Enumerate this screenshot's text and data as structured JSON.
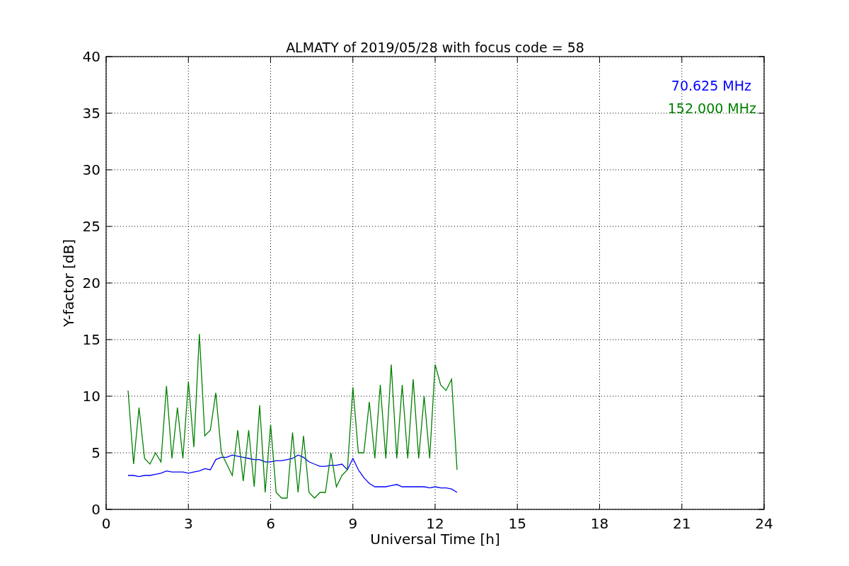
{
  "figure": {
    "chart_data": {
      "type": "line",
      "title": "ALMATY of 2019/05/28 with focus code = 58",
      "xlabel": "Universal Time [h]",
      "ylabel": "Y-factor [dB]",
      "grid": true,
      "xlim": [
        0,
        24
      ],
      "ylim": [
        0,
        40
      ],
      "xticks": [
        0,
        3,
        6,
        9,
        12,
        15,
        18,
        21,
        24
      ],
      "yticks": [
        0,
        5,
        10,
        15,
        20,
        25,
        30,
        35,
        40
      ],
      "x": [
        0.8,
        1.0,
        1.2,
        1.4,
        1.6,
        1.8,
        2.0,
        2.2,
        2.4,
        2.6,
        2.8,
        3.0,
        3.2,
        3.4,
        3.6,
        3.8,
        4.0,
        4.2,
        4.4,
        4.6,
        4.8,
        5.0,
        5.2,
        5.4,
        5.6,
        5.8,
        6.0,
        6.2,
        6.4,
        6.6,
        6.8,
        7.0,
        7.2,
        7.4,
        7.6,
        7.8,
        8.0,
        8.2,
        8.4,
        8.6,
        8.8,
        9.0,
        9.2,
        9.4,
        9.6,
        9.8,
        10.0,
        10.2,
        10.4,
        10.6,
        10.8,
        11.0,
        11.2,
        11.4,
        11.6,
        11.8,
        12.0,
        12.2,
        12.4,
        12.6,
        12.8
      ],
      "series": [
        {
          "name": "70.625 MHz",
          "color": "#0000ff",
          "values": [
            3.0,
            3.0,
            2.9,
            3.0,
            3.0,
            3.1,
            3.2,
            3.4,
            3.3,
            3.3,
            3.3,
            3.2,
            3.3,
            3.4,
            3.6,
            3.5,
            4.4,
            4.6,
            4.6,
            4.8,
            4.7,
            4.6,
            4.5,
            4.4,
            4.4,
            4.2,
            4.2,
            4.3,
            4.3,
            4.4,
            4.5,
            4.8,
            4.6,
            4.2,
            4.0,
            3.8,
            3.8,
            3.9,
            3.9,
            4.0,
            3.5,
            4.5,
            3.5,
            2.8,
            2.3,
            2.0,
            2.0,
            2.0,
            2.1,
            2.2,
            2.0,
            2.0,
            2.0,
            2.0,
            2.0,
            1.9,
            2.0,
            1.9,
            1.9,
            1.8,
            1.5
          ]
        },
        {
          "name": "152.000 MHz",
          "color": "#008000",
          "values": [
            10.5,
            4.0,
            9.0,
            4.5,
            4.0,
            5.0,
            4.2,
            10.9,
            4.5,
            9.0,
            4.5,
            11.3,
            5.5,
            15.5,
            6.5,
            7.0,
            10.3,
            5.0,
            4.0,
            3.0,
            7.0,
            2.5,
            7.0,
            2.0,
            9.2,
            1.5,
            7.5,
            1.5,
            1.0,
            1.0,
            6.8,
            1.5,
            6.5,
            1.5,
            1.0,
            1.5,
            1.5,
            5.0,
            2.0,
            3.0,
            3.5,
            10.8,
            5.0,
            5.0,
            9.5,
            4.5,
            11.0,
            4.5,
            12.8,
            4.5,
            11.0,
            4.5,
            11.5,
            4.5,
            10.0,
            4.5,
            12.8,
            11.0,
            10.5,
            11.5,
            3.5
          ]
        }
      ]
    }
  }
}
